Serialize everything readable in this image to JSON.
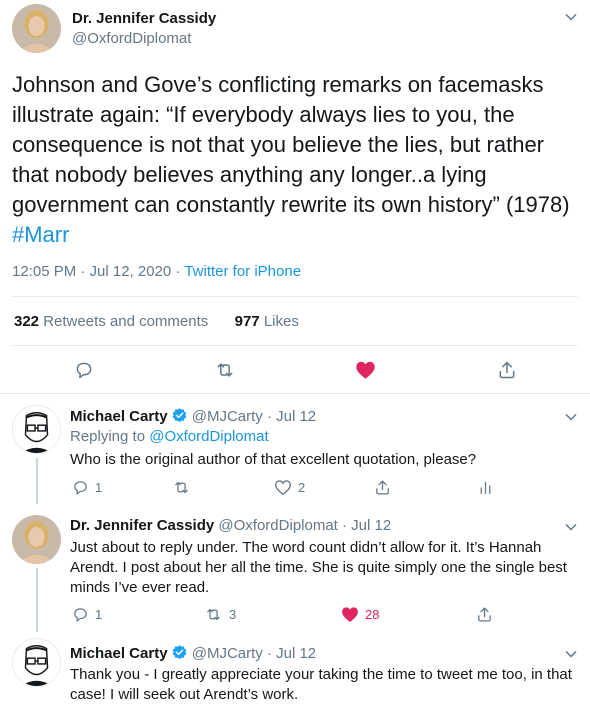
{
  "main_tweet": {
    "author_name": "Dr. Jennifer Cassidy",
    "handle": "@OxfordDiplomat",
    "text": "Johnson and Gove’s conflicting remarks on facemasks illustrate again: “If everybody always lies to you, the consequence is not that you believe the lies, but rather that nobody believes anything any longer..a lying government can constantly rewrite its own history” (1978) ",
    "hashtag": "#Marr",
    "timestamp": "12:05 PM · Jul 12, 2020",
    "separator": " · ",
    "source": "Twitter for iPhone",
    "retweets_count": "322",
    "retweets_label": "Retweets and comments",
    "likes_count": "977",
    "likes_label": "Likes",
    "liked": true
  },
  "replies": [
    {
      "author_name": "Michael Carty",
      "verified": true,
      "handle": "@MJCarty",
      "date": " · Jul 12",
      "replying_prefix": "Replying to ",
      "replying_to": "@OxfordDiplomat",
      "text": "Who is the original author of that excellent quotation, please?",
      "reply_count": "1",
      "retweet_count": "",
      "like_count": "2"
    },
    {
      "author_name": "Dr. Jennifer Cassidy",
      "verified": false,
      "handle": "@OxfordDiplomat",
      "date": " · Jul 12",
      "text": "Just about to reply under. The word count didn’t allow for it. It’s Hannah Arendt. I post about her all the time. She is quite simply one the single best minds I’ve ever read.",
      "reply_count": "1",
      "retweet_count": "3",
      "like_count": "28",
      "liked": true
    },
    {
      "author_name": "Michael Carty",
      "verified": true,
      "handle": "@MJCarty",
      "date": " · Jul 12",
      "text": "Thank you - I greatly appreciate your taking the time to tweet me too, in that case! I will seek out Arendt’s work."
    }
  ],
  "colors": {
    "accent": "#1b95e0",
    "like": "#e0245e",
    "muted": "#657786",
    "text": "#14171a",
    "divider": "#e6ecf0"
  },
  "icons": [
    "chevron-down-icon",
    "reply-icon",
    "retweet-icon",
    "heart-icon",
    "share-icon",
    "analytics-icon",
    "verified-badge-icon"
  ]
}
